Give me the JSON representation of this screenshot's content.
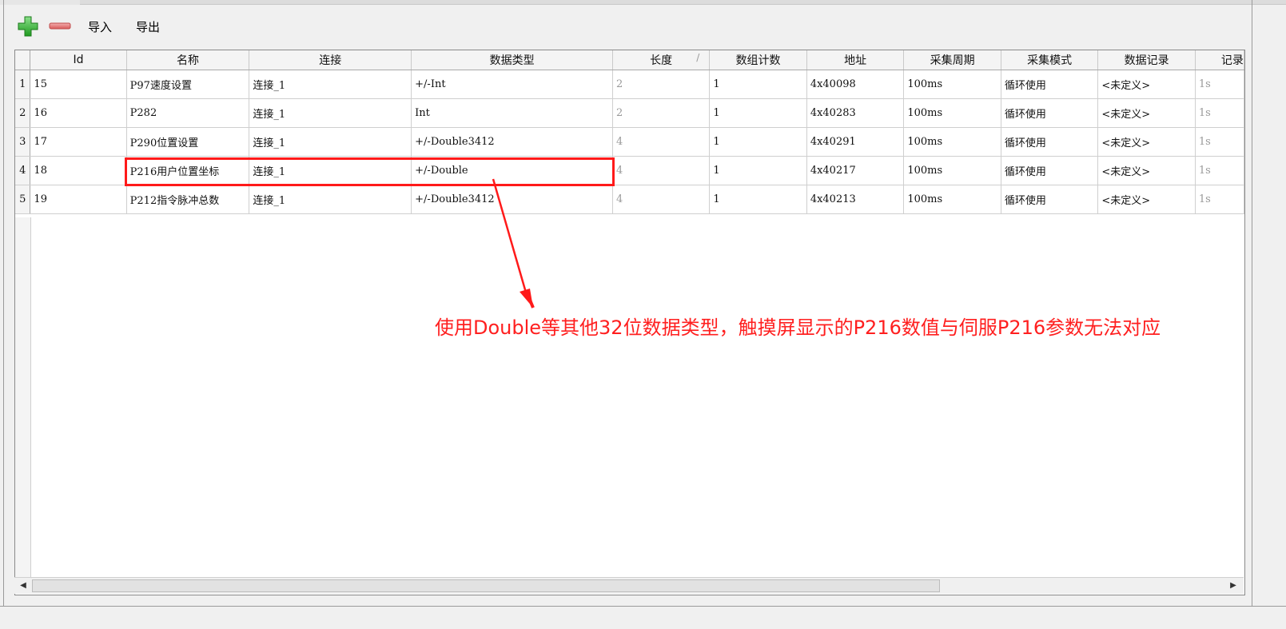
{
  "toolbar": {
    "import_label": "导入",
    "export_label": "导出",
    "add_icon_color": "#2fb52f",
    "remove_icon_color": "#e07070"
  },
  "grid": {
    "columns": [
      {
        "key": "id",
        "label": "Id"
      },
      {
        "key": "name",
        "label": "名称"
      },
      {
        "key": "conn",
        "label": "连接"
      },
      {
        "key": "dtype",
        "label": "数据类型"
      },
      {
        "key": "len",
        "label": "长度"
      },
      {
        "key": "count",
        "label": "数组计数"
      },
      {
        "key": "addr",
        "label": "地址"
      },
      {
        "key": "period",
        "label": "采集周期"
      },
      {
        "key": "mode",
        "label": "采集模式"
      },
      {
        "key": "record",
        "label": "数据记录"
      },
      {
        "key": "rec2",
        "label": "记录"
      }
    ],
    "sort_glyph": "/",
    "rows": [
      {
        "num": "1",
        "id": "15",
        "name": "P97速度设置",
        "conn": "连接_1",
        "dtype": "+/-Int",
        "len": "2",
        "count": "1",
        "addr": "4x40098",
        "period": "100ms",
        "mode": "循环使用",
        "record": "<未定义>",
        "rec2": "1s"
      },
      {
        "num": "2",
        "id": "16",
        "name": "P282",
        "conn": "连接_1",
        "dtype": "Int",
        "len": "2",
        "count": "1",
        "addr": "4x40283",
        "period": "100ms",
        "mode": "循环使用",
        "record": "<未定义>",
        "rec2": "1s"
      },
      {
        "num": "3",
        "id": "17",
        "name": "P290位置设置",
        "conn": "连接_1",
        "dtype": "+/-Double3412",
        "len": "4",
        "count": "1",
        "addr": "4x40291",
        "period": "100ms",
        "mode": "循环使用",
        "record": "<未定义>",
        "rec2": "1s"
      },
      {
        "num": "4",
        "id": "18",
        "name": "P216用户位置坐标",
        "conn": "连接_1",
        "dtype": "+/-Double",
        "len": "4",
        "count": "1",
        "addr": "4x40217",
        "period": "100ms",
        "mode": "循环使用",
        "record": "<未定义>",
        "rec2": "1s"
      },
      {
        "num": "5",
        "id": "19",
        "name": "P212指令脉冲总数",
        "conn": "连接_1",
        "dtype": "+/-Double3412",
        "len": "4",
        "count": "1",
        "addr": "4x40213",
        "period": "100ms",
        "mode": "循环使用",
        "record": "<未定义>",
        "rec2": "1s"
      }
    ]
  },
  "annotation": {
    "text": "使用Double等其他32位数据类型，触摸屏显示的P216数值与伺服P216参数无法对应",
    "color": "#ff1f1f"
  },
  "scrollbar": {
    "left_arrow": "◀",
    "right_arrow": "▶"
  }
}
